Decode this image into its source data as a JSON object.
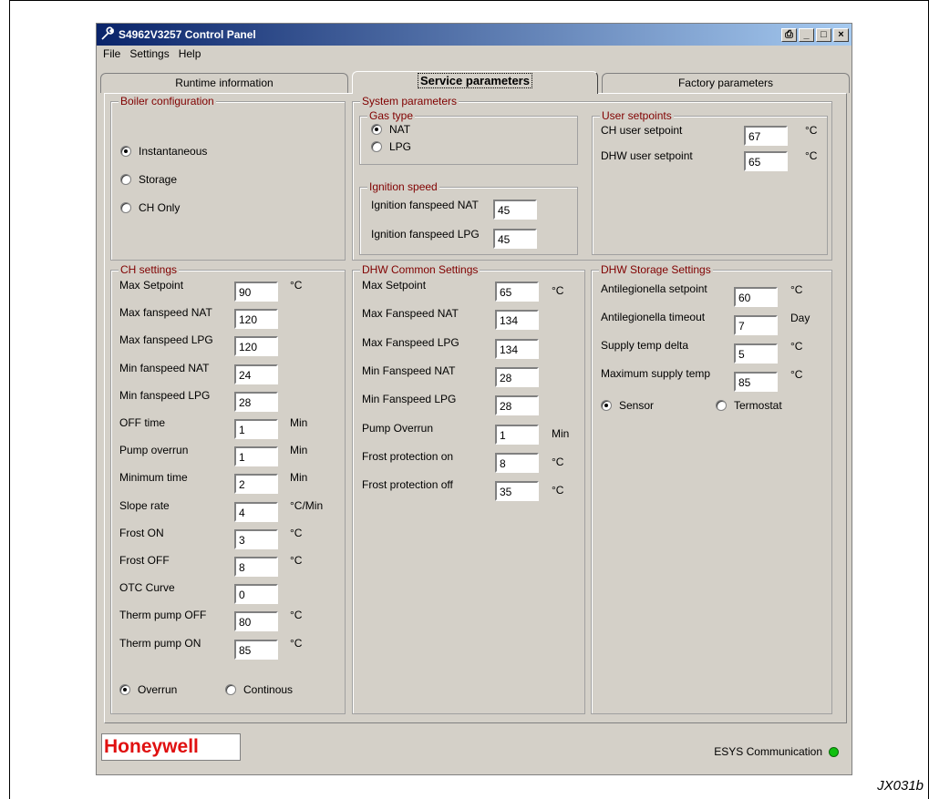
{
  "window": {
    "title": "S4962V3257 Control Panel"
  },
  "menu": [
    "File",
    "Settings",
    "Help"
  ],
  "tabs": [
    "Runtime information",
    "Service parameters",
    "Factory parameters"
  ],
  "boiler_configuration": {
    "legend": "Boiler configuration",
    "options": [
      "Instantaneous",
      "Storage",
      "CH Only"
    ],
    "selected": "Instantaneous"
  },
  "system_parameters": {
    "legend": "System parameters",
    "gas_type": {
      "legend": "Gas type",
      "options": [
        "NAT",
        "LPG"
      ],
      "selected": "NAT"
    },
    "ignition_speed": {
      "legend": "Ignition speed",
      "fields": [
        {
          "label": "Ignition fanspeed NAT",
          "value": "45"
        },
        {
          "label": "Ignition fanspeed LPG",
          "value": "45"
        }
      ]
    },
    "user_setpoints": {
      "legend": "User setpoints",
      "fields": [
        {
          "label": "CH user setpoint",
          "value": "67",
          "unit": "°C"
        },
        {
          "label": "DHW user setpoint",
          "value": "65",
          "unit": "°C"
        }
      ]
    }
  },
  "ch_settings": {
    "legend": "CH settings",
    "fields": [
      {
        "label": "Max Setpoint",
        "value": "90",
        "unit": "°C"
      },
      {
        "label": "Max fanspeed NAT",
        "value": "120",
        "unit": ""
      },
      {
        "label": "Max fanspeed LPG",
        "value": "120",
        "unit": ""
      },
      {
        "label": "Min fanspeed NAT",
        "value": "24",
        "unit": ""
      },
      {
        "label": "Min fanspeed LPG",
        "value": "28",
        "unit": ""
      },
      {
        "label": "OFF time",
        "value": "1",
        "unit": "Min"
      },
      {
        "label": "Pump overrun",
        "value": "1",
        "unit": "Min"
      },
      {
        "label": "Minimum time",
        "value": "2",
        "unit": "Min"
      },
      {
        "label": "Slope rate",
        "value": "4",
        "unit": "°C/Min"
      },
      {
        "label": "Frost ON",
        "value": "3",
        "unit": "°C"
      },
      {
        "label": "Frost OFF",
        "value": "8",
        "unit": "°C"
      },
      {
        "label": "OTC Curve",
        "value": "0",
        "unit": ""
      },
      {
        "label": "Therm pump OFF",
        "value": "80",
        "unit": "°C"
      },
      {
        "label": "Therm pump ON",
        "value": "85",
        "unit": "°C"
      }
    ],
    "mode_options": [
      "Overrun",
      "Continous"
    ],
    "mode_selected": "Overrun"
  },
  "dhw_common": {
    "legend": "DHW Common Settings",
    "fields": [
      {
        "label": "Max Setpoint",
        "value": "65",
        "unit": "°C"
      },
      {
        "label": "Max Fanspeed NAT",
        "value": "134",
        "unit": ""
      },
      {
        "label": "Max Fanspeed LPG",
        "value": "134",
        "unit": ""
      },
      {
        "label": "Min Fanspeed NAT",
        "value": "28",
        "unit": ""
      },
      {
        "label": "Min Fanspeed LPG",
        "value": "28",
        "unit": ""
      },
      {
        "label": "Pump Overrun",
        "value": "1",
        "unit": "Min"
      },
      {
        "label": "Frost protection on",
        "value": "8",
        "unit": "°C"
      },
      {
        "label": "Frost protection off",
        "value": "35",
        "unit": "°C"
      }
    ]
  },
  "dhw_storage": {
    "legend": "DHW Storage Settings",
    "fields": [
      {
        "label": "Antilegionella setpoint",
        "value": "60",
        "unit": "°C"
      },
      {
        "label": "Antilegionella timeout",
        "value": "7",
        "unit": "Day"
      },
      {
        "label": "Supply temp delta",
        "value": "5",
        "unit": "°C"
      },
      {
        "label": "Maximum supply temp",
        "value": "85",
        "unit": "°C"
      }
    ],
    "sensor_options": [
      "Sensor",
      "Termostat"
    ],
    "sensor_selected": "Sensor"
  },
  "statusbar": {
    "logo_text": "Honeywell",
    "comm_label": "ESYS Communication",
    "led_color": "#10c010"
  },
  "figure_id": "JX031b"
}
